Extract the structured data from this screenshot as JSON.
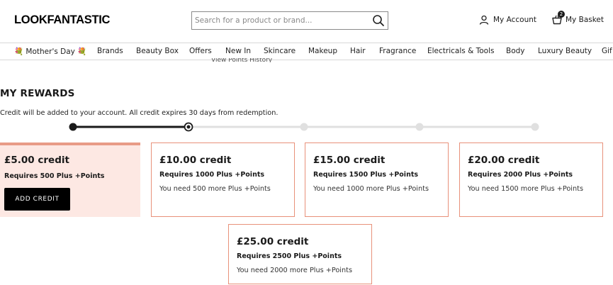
{
  "header": {
    "logo": "LOOKFANTASTIC",
    "search_placeholder": "Search for a product or brand...",
    "account_label": "My Account",
    "basket_label": "My Basket",
    "basket_count": "2"
  },
  "nav": {
    "items": [
      "💐 Mother's Day 💐",
      "Brands",
      "Beauty Box",
      "Offers",
      "New In",
      "Skincare",
      "Makeup",
      "Hair",
      "Fragrance",
      "Electricals & Tools",
      "Body",
      "Luxury Beauty",
      "Gif"
    ]
  },
  "partial_link": "View Points History",
  "rewards": {
    "title": "MY REWARDS",
    "subtitle": "Credit will be added to your account. All credit expires 30 days from redemption.",
    "progress_reached_steps": 2,
    "progress_total_steps": 5,
    "cards": [
      {
        "amount": "£5.00 credit",
        "requires": "Requires 500 Plus +Points",
        "button": "ADD CREDIT"
      },
      {
        "amount": "£10.00 credit",
        "requires": "Requires 1000 Plus +Points",
        "need": "You need 500 more Plus +Points"
      },
      {
        "amount": "£15.00 credit",
        "requires": "Requires 1500 Plus +Points",
        "need": "You need 1000 more Plus +Points"
      },
      {
        "amount": "£20.00 credit",
        "requires": "Requires 2000 Plus +Points",
        "need": "You need 1500 more Plus +Points"
      },
      {
        "amount": "£25.00 credit",
        "requires": "Requires 2500 Plus +Points",
        "need": "You need 2000 more Plus +Points"
      }
    ]
  },
  "colors": {
    "card_border": "#e8917a",
    "active_card_bg": "#fde8e3",
    "progress_active": "#1a1a1a",
    "progress_inactive": "#e0e0e0"
  }
}
